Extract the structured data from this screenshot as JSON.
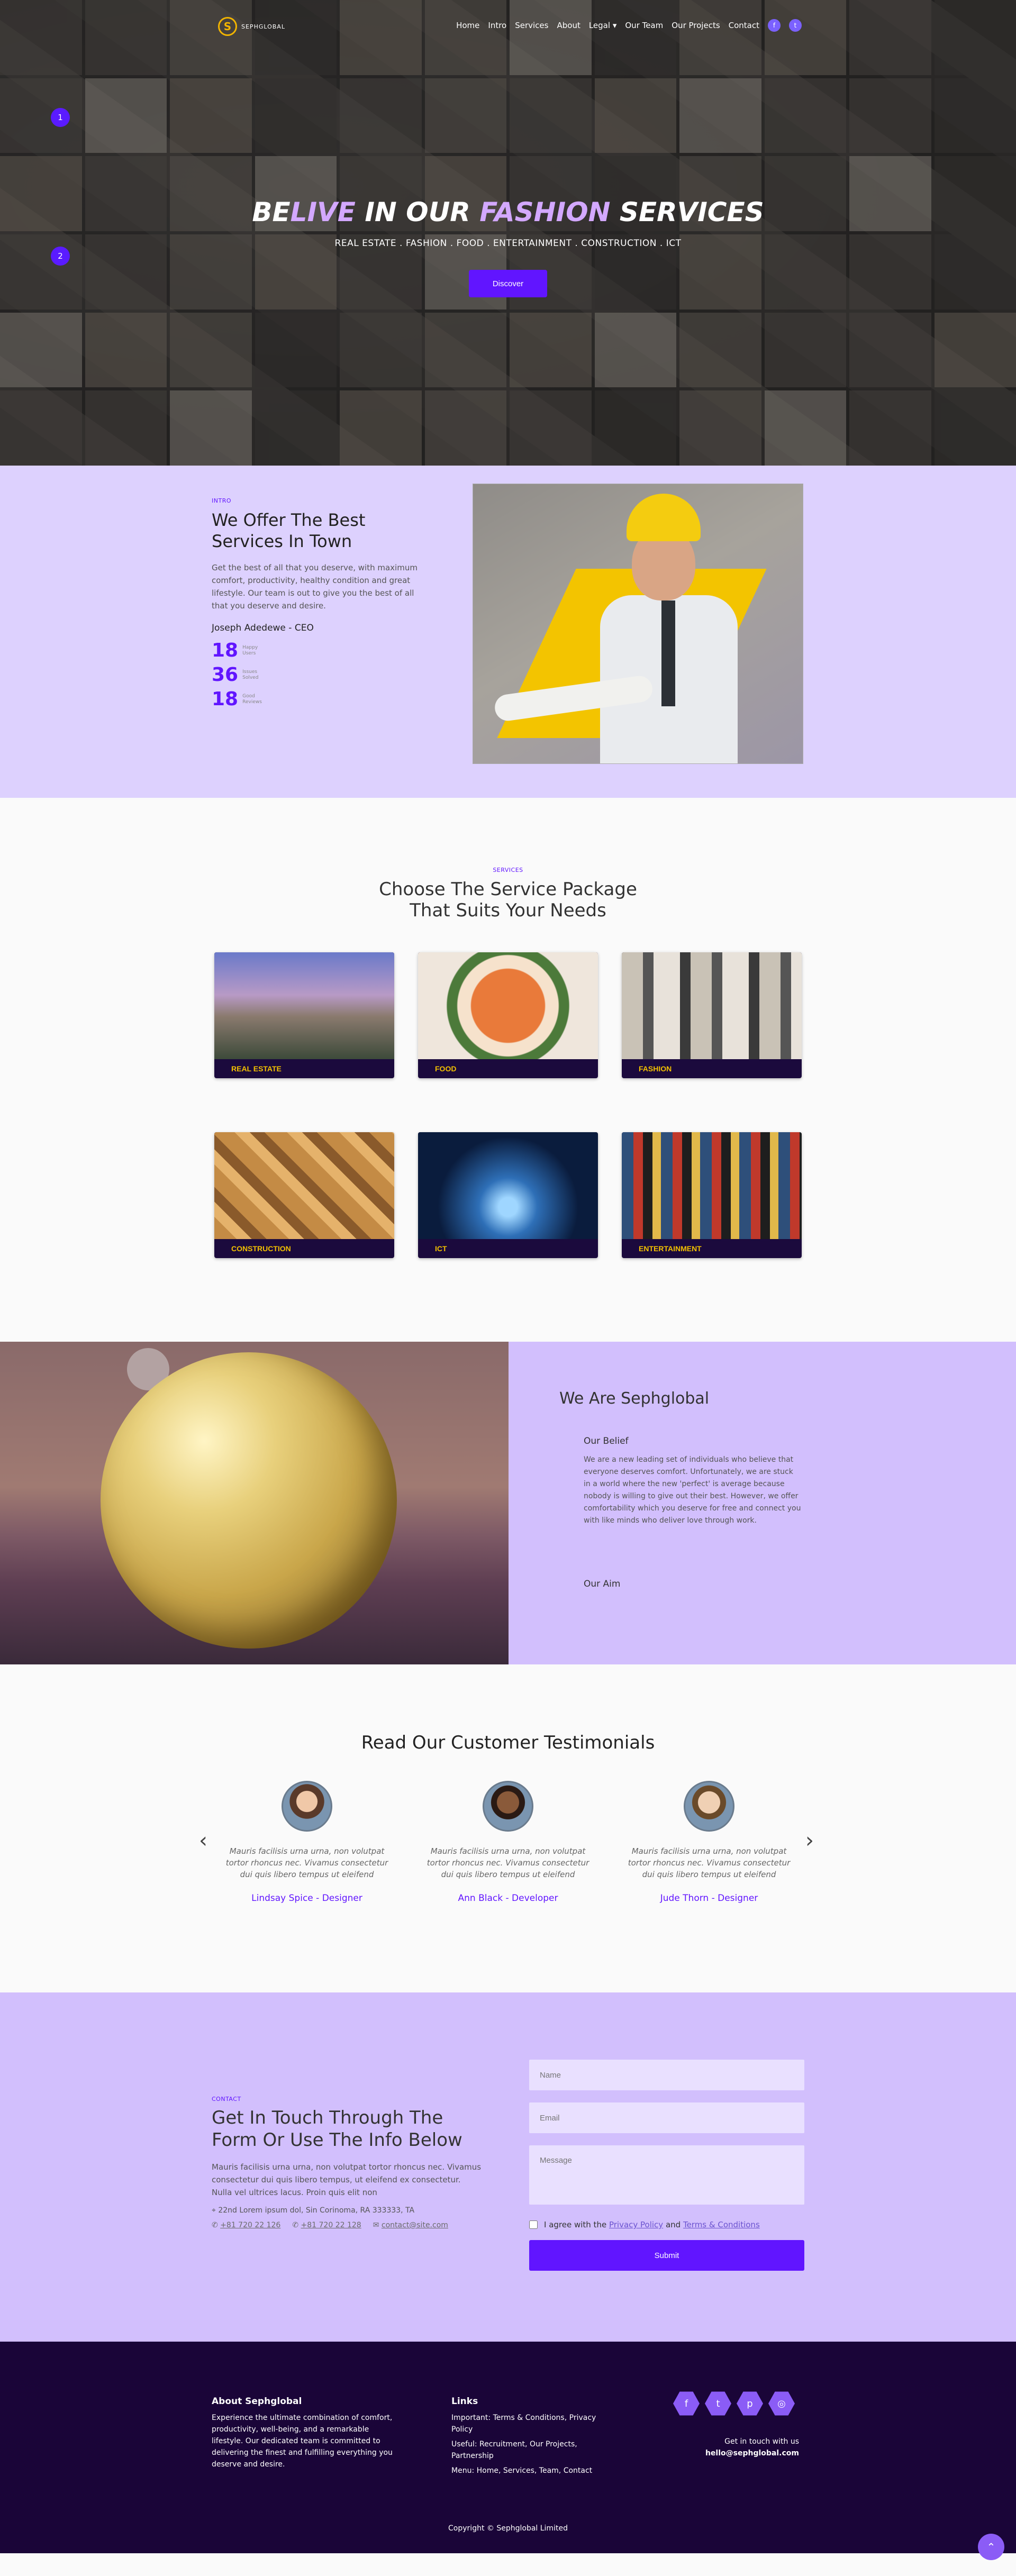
{
  "nav": {
    "logo_text": "SEPHGLOBAL",
    "logo_mark": "S",
    "items": [
      "Home",
      "Intro",
      "Services",
      "About",
      "Legal ▾",
      "Our Team",
      "Our Projects",
      "Contact"
    ],
    "social": [
      "facebook-icon",
      "twitter-icon"
    ]
  },
  "hero": {
    "slides": [
      "1",
      "2"
    ],
    "title_a": "BE",
    "title_b": "LIVE",
    "title_c": " IN OUR ",
    "title_d": "FASHION",
    "title_e": " SERVICES",
    "subtitle": "REAL ESTATE . FASHION . FOOD . ENTERTAINMENT . CONSTRUCTION . ICT",
    "button": "Discover"
  },
  "intro": {
    "eyebrow": "INTRO",
    "title": "We Offer The Best Services In Town",
    "body": "Get the best of all that you deserve, with maximum comfort, productivity, healthy condition and great lifestyle. Our team is out to give you the best of all that you deserve and desire.",
    "ceo": "Joseph Adedewe - CEO",
    "stats": [
      {
        "num": "18",
        "label": "Happy Users"
      },
      {
        "num": "36",
        "label": "Issues Solved"
      },
      {
        "num": "18",
        "label": "Good Reviews"
      }
    ]
  },
  "services": {
    "eyebrow": "SERVICES",
    "title": "Choose The Service Package That Suits Your Needs",
    "cards": [
      "REAL ESTATE",
      "FOOD",
      "FASHION",
      "CONSTRUCTION",
      "ICT",
      "ENTERTAINMENT"
    ]
  },
  "about": {
    "title": "We Are Sephglobal",
    "belief_title": "Our Belief",
    "belief_body": "We are a new leading set of individuals who believe that everyone deserves comfort. Unfortunately, we are stuck in a world where the new 'perfect' is average because nobody is willing to give out their best. However, we offer comfortability which you deserve for free and connect you with like minds who deliver love through work.",
    "aim_title": "Our Aim"
  },
  "testimonials": {
    "title": "Read Our Customer Testimonials",
    "items": [
      {
        "quote": "Mauris facilisis urna urna, non volutpat tortor rhoncus nec. Vivamus consectetur dui quis libero tempus ut eleifend",
        "who": "Lindsay Spice - Designer"
      },
      {
        "quote": "Mauris facilisis urna urna, non volutpat tortor rhoncus nec. Vivamus consectetur dui quis libero tempus ut eleifend",
        "who": "Ann Black - Developer"
      },
      {
        "quote": "Mauris facilisis urna urna, non volutpat tortor rhoncus nec. Vivamus consectetur dui quis libero tempus ut eleifend",
        "who": "Jude Thorn - Designer"
      }
    ],
    "prev": "‹",
    "next": "›"
  },
  "contact": {
    "eyebrow": "CONTACT",
    "title": "Get In Touch Through The Form Or Use The Info Below",
    "body": "Mauris facilisis urna urna, non volutpat tortor rhoncus nec. Vivamus consectetur dui quis libero tempus, ut eleifend ex consectetur. Nulla vel ultrices lacus. Proin quis elit non",
    "address": "22nd Lorem ipsum dol, Sin Corinoma, RA 333333, TA",
    "phone1": "+81 720 22 126",
    "phone2": "+81 720 22 128",
    "email": "contact@site.com",
    "name_ph": "Name",
    "email_ph": "Email",
    "message_ph": "Message",
    "agree_a": "I agree with the ",
    "privacy": "Privacy Policy",
    "agree_b": " and ",
    "terms": "Terms & Conditions",
    "submit": "Submit"
  },
  "footer": {
    "about_title": "About Sephglobal",
    "about_body": "Experience the ultimate combination of comfort, productivity, well-being, and a remarkable lifestyle. Our dedicated team is committed to delivering the finest and fulfilling everything you deserve and desire.",
    "links_title": "Links",
    "link1": "Important: Terms & Conditions, Privacy Policy",
    "link2": "Useful: Recruitment, Our Projects, Partnership",
    "link3": "Menu: Home, Services, Team, Contact",
    "social": [
      "f",
      "t",
      "p",
      "◎"
    ],
    "get_in_touch": "Get in touch with us",
    "email": "hello@sephglobal.com",
    "copyright": "Copyright © Sephglobal Limited",
    "totop": "⌃"
  }
}
